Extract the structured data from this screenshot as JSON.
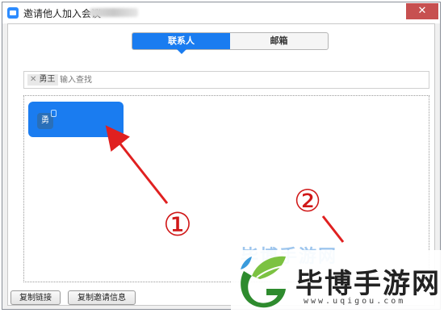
{
  "window": {
    "title": "邀请他人加入会议",
    "close_label": "✕"
  },
  "tabs": [
    {
      "label": "联系人",
      "active": true
    },
    {
      "label": "邮箱",
      "active": false
    }
  ],
  "search": {
    "chip_label": "勇王",
    "chip_remove": "✕",
    "placeholder": "输入查找"
  },
  "contacts": [
    {
      "avatar_text": "勇",
      "selected": true
    }
  ],
  "footer": {
    "copy_link_label": "复制链接",
    "copy_invite_label": "复制邀请信息"
  },
  "annotations": {
    "marker_1": "①",
    "marker_2": "②",
    "arrow_color": "#e02020"
  },
  "watermark": {
    "brand": "毕博手游网",
    "url": "www.uqigou.com",
    "faded_text": "毕博手游网"
  },
  "colors": {
    "accent": "#1a7cf0",
    "close": "#c75050"
  }
}
